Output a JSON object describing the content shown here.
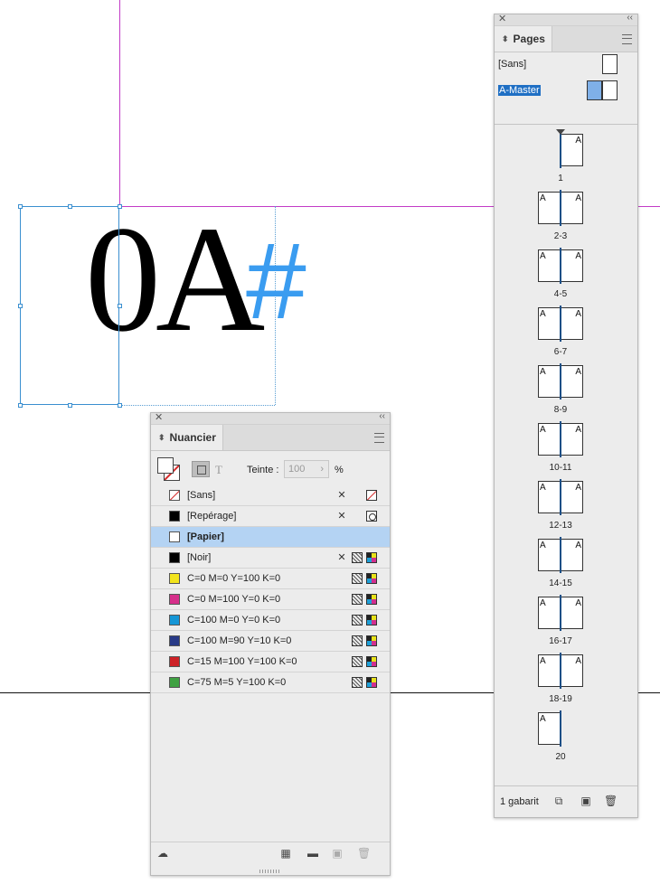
{
  "canvas": {
    "glyph_text": "0A",
    "glyph_hash": "#",
    "hash_color": "#3a9cf0",
    "guide_color": "#c23bc7",
    "frame_color": "#3a8fd0"
  },
  "pages_panel": {
    "tab_label": "Pages",
    "masters": [
      {
        "label": "[Sans]",
        "selected": false
      },
      {
        "label": "A-Master",
        "selected": true
      }
    ],
    "spreads": [
      {
        "label": "1",
        "pages": 1,
        "letters": [
          "A"
        ]
      },
      {
        "label": "2-3",
        "pages": 2,
        "letters": [
          "A",
          "A"
        ]
      },
      {
        "label": "4-5",
        "pages": 2,
        "letters": [
          "A",
          "A"
        ]
      },
      {
        "label": "6-7",
        "pages": 2,
        "letters": [
          "A",
          "A"
        ]
      },
      {
        "label": "8-9",
        "pages": 2,
        "letters": [
          "A",
          "A"
        ]
      },
      {
        "label": "10-11",
        "pages": 2,
        "letters": [
          "A",
          "A"
        ]
      },
      {
        "label": "12-13",
        "pages": 2,
        "letters": [
          "A",
          "A"
        ]
      },
      {
        "label": "14-15",
        "pages": 2,
        "letters": [
          "A",
          "A"
        ]
      },
      {
        "label": "16-17",
        "pages": 2,
        "letters": [
          "A",
          "A"
        ]
      },
      {
        "label": "18-19",
        "pages": 2,
        "letters": [
          "A",
          "A"
        ]
      },
      {
        "label": "20",
        "pages": 1,
        "letters": [
          "A"
        ]
      }
    ],
    "footer_text": "1 gabarit"
  },
  "swatches_panel": {
    "tab_label": "Nuancier",
    "tint_label": "Teinte :",
    "tint_value": "100",
    "tint_unit": "%",
    "swatches": [
      {
        "name": "[Sans]",
        "color": "none",
        "selected": false,
        "icons": [
          "pencil-cross",
          "none"
        ]
      },
      {
        "name": "[Repérage]",
        "color": "#000000",
        "selected": false,
        "icons": [
          "pencil-cross",
          "registration"
        ]
      },
      {
        "name": "[Papier]",
        "color": "#ffffff",
        "selected": true,
        "icons": []
      },
      {
        "name": "[Noir]",
        "color": "#000000",
        "selected": false,
        "icons": [
          "pencil-cross",
          "process",
          "cmyk"
        ]
      },
      {
        "name": "C=0 M=0 Y=100 K=0",
        "color": "#f2e41c",
        "selected": false,
        "icons": [
          "process",
          "cmyk"
        ]
      },
      {
        "name": "C=0 M=100 Y=0 K=0",
        "color": "#d62f8a",
        "selected": false,
        "icons": [
          "process",
          "cmyk"
        ]
      },
      {
        "name": "C=100 M=0 Y=0 K=0",
        "color": "#1596d6",
        "selected": false,
        "icons": [
          "process",
          "cmyk"
        ]
      },
      {
        "name": "C=100 M=90 Y=10 K=0",
        "color": "#283a87",
        "selected": false,
        "icons": [
          "process",
          "cmyk"
        ]
      },
      {
        "name": "C=15 M=100 Y=100 K=0",
        "color": "#cd2127",
        "selected": false,
        "icons": [
          "process",
          "cmyk"
        ]
      },
      {
        "name": "C=75 M=5 Y=100 K=0",
        "color": "#3fa142",
        "selected": false,
        "icons": [
          "process",
          "cmyk"
        ]
      }
    ]
  }
}
